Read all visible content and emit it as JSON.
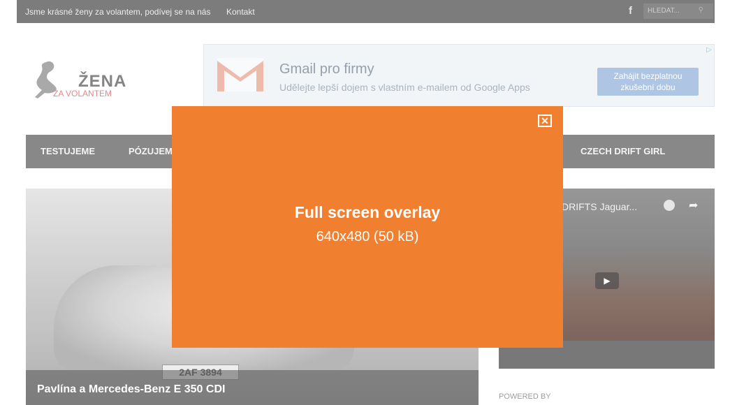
{
  "topbar": {
    "link1": "Jsme krásné ženy za volantem, podívej se na nás",
    "link2": "Kontakt",
    "facebook_icon": "f",
    "search_placeholder": "HLEDAT...",
    "search_icon": "⚲"
  },
  "logo": {
    "line1": "ŽENA",
    "line2": "ZA VOLANTEM"
  },
  "ad": {
    "title": "Gmail pro firmy",
    "subtitle": "Udělejte lepší dojem s vlastním e-mailem od Google Apps",
    "cta": "Zahájit bezplatnou zkušební dobu",
    "adchoices_icon": "ad-choices-icon"
  },
  "nav": {
    "items": [
      "TESTUJEME",
      "PÓZUJEME",
      "CZECH DRIFT GIRL"
    ]
  },
  "hero": {
    "plate": "2AF 3894",
    "caption": "Pavlína a Mercedes-Benz E 350 CDI"
  },
  "video": {
    "title": "DRIFTS Jaguar...",
    "play_icon": "▶",
    "share_icon": "➦"
  },
  "powered_by": "POWERED BY",
  "overlay": {
    "heading": "Full screen overlay",
    "subheading": "640x480 (50 kB)",
    "close_icon": "✕",
    "color": "#f07f2f"
  }
}
